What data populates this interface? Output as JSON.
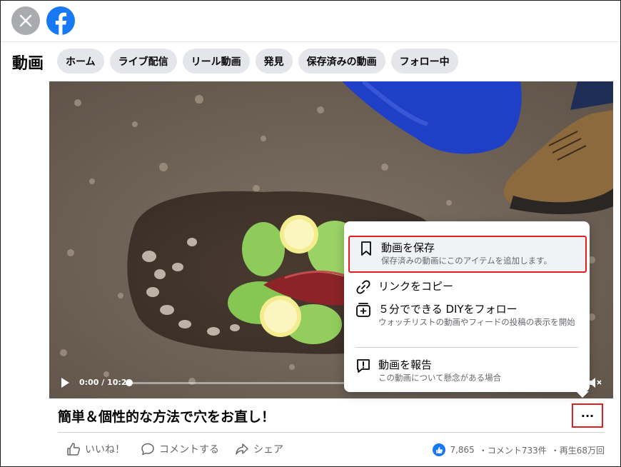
{
  "header": {
    "close_icon": "close-icon",
    "logo_icon": "facebook-logo-icon",
    "brand_color": "#1877f2"
  },
  "nav": {
    "title": "動画",
    "tabs": [
      {
        "label": "ホーム"
      },
      {
        "label": "ライブ配信"
      },
      {
        "label": "リール動画"
      },
      {
        "label": "発見"
      },
      {
        "label": "保存済みの動画"
      },
      {
        "label": "フォロー中"
      }
    ]
  },
  "video": {
    "time": "0:00 / 10:21",
    "progress": 0.0,
    "title": "簡単＆個性的な方法で穴をお直し！"
  },
  "menu": {
    "items": [
      {
        "icon": "bookmark-icon",
        "label": "動画を保存",
        "sub": "保存済みの動画にこのアイテムを追加します。"
      },
      {
        "icon": "link-icon",
        "label": "リンクをコピー",
        "sub": ""
      },
      {
        "icon": "follow-icon",
        "label": "５分でできる DIYをフォロー",
        "sub": "ウォッチリストの動画やフィードの投稿の表示を開始"
      },
      {
        "icon": "report-icon",
        "label": "動画を報告",
        "sub": "この動画について懸念がある場合"
      }
    ],
    "highlight_color": "#e02020"
  },
  "actions": {
    "like": "いいね！",
    "comment": "コメントする",
    "share": "シェア"
  },
  "stats": {
    "likes": "7,865",
    "comments": "・コメント733件",
    "views": "・再生68万回"
  },
  "more_button": "···"
}
